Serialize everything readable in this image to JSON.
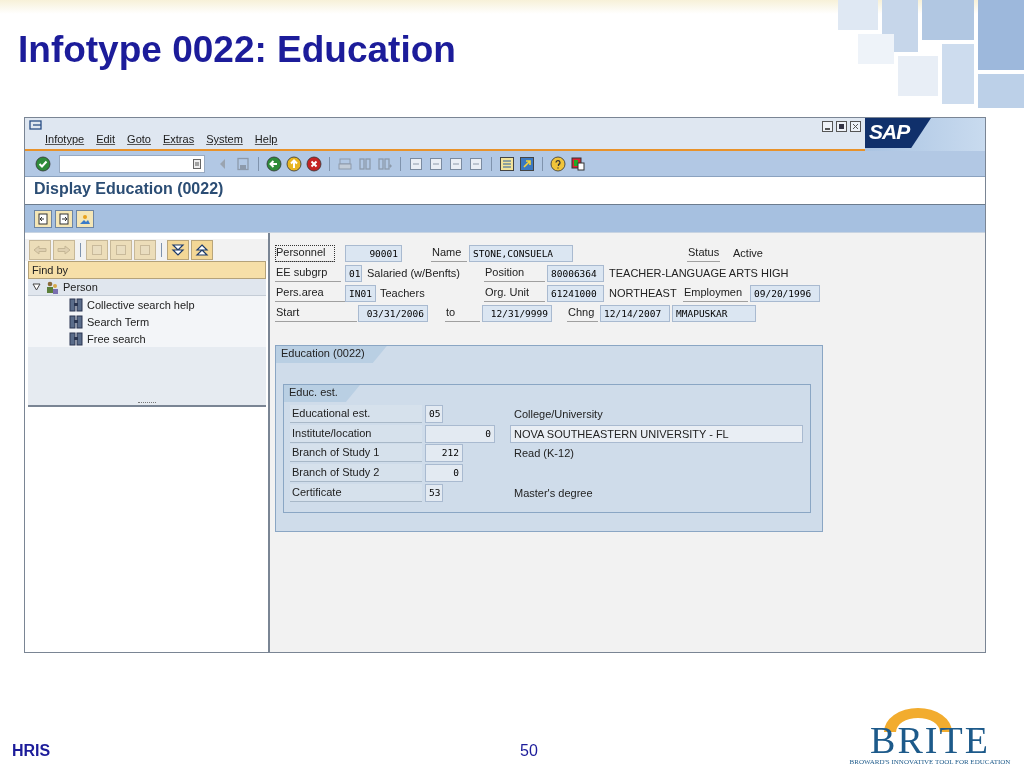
{
  "slide": {
    "title": "Infotype 0022: Education",
    "footer_left": "HRIS",
    "page_number": "50",
    "logo": {
      "name": "BRITE",
      "tagline": "BROWARD'S INNOVATIVE TOOL FOR EDUCATION"
    }
  },
  "window": {
    "menu": [
      {
        "label": "Infotype"
      },
      {
        "label": "Edit"
      },
      {
        "label": "Goto"
      },
      {
        "label": "Extras"
      },
      {
        "label": "System"
      },
      {
        "label": "Help"
      }
    ],
    "logo": "SAP",
    "screen_title": "Display Education (0022)",
    "navigator": {
      "find_by": "Find by",
      "tree": [
        {
          "label": "Person",
          "expanded": true,
          "children": [
            {
              "label": "Collective search help"
            },
            {
              "label": "Search Term"
            },
            {
              "label": "Free search"
            }
          ]
        }
      ]
    },
    "header": [
      [
        {
          "kind": "label",
          "text": "Personnel",
          "focused": true
        },
        {
          "kind": "field",
          "text": "90001"
        },
        {
          "kind": "label",
          "text": "Name",
          "focused": false
        },
        {
          "kind": "field",
          "text": "STONE,CONSUELA"
        },
        {
          "kind": "label",
          "text": "Status",
          "focused": false
        },
        {
          "kind": "text",
          "text": "Active"
        }
      ],
      [
        {
          "kind": "label",
          "text": "EE subgrp",
          "focused": false
        },
        {
          "kind": "field",
          "text": "01"
        },
        {
          "kind": "text",
          "text": "Salaried (w/Benfts)"
        },
        {
          "kind": "label",
          "text": "Position",
          "focused": false
        },
        {
          "kind": "field",
          "text": "80006364"
        },
        {
          "kind": "text",
          "text": "TEACHER-LANGUAGE ARTS HIGH"
        }
      ],
      [
        {
          "kind": "label",
          "text": "Pers.area",
          "focused": false
        },
        {
          "kind": "field",
          "text": "IN01"
        },
        {
          "kind": "text",
          "text": "Teachers"
        },
        {
          "kind": "label",
          "text": "Org. Unit",
          "focused": false
        },
        {
          "kind": "field",
          "text": "61241000"
        },
        {
          "kind": "text",
          "text": "NORTHEAST"
        },
        {
          "kind": "label",
          "text": "Employmen",
          "focused": false
        },
        {
          "kind": "field",
          "text": "09/20/1996"
        }
      ],
      [
        {
          "kind": "label",
          "text": "Start",
          "focused": false
        },
        {
          "kind": "field",
          "text": "03/31/2006"
        },
        {
          "kind": "label",
          "text": "to",
          "focused": false
        },
        {
          "kind": "field",
          "text": "12/31/9999"
        },
        {
          "kind": "label",
          "text": "Chng",
          "focused": false
        },
        {
          "kind": "field",
          "text": "12/14/2007"
        },
        {
          "kind": "field",
          "text": "MMAPUSKAR"
        }
      ]
    ],
    "education_frame": {
      "title": "Education (0022)",
      "group": {
        "title": "Educ. est.",
        "rows": [
          {
            "label": "Educational est.",
            "value": "05",
            "description": {
              "text": "College/University",
              "boxed": false
            }
          },
          {
            "label": "Institute/location",
            "value": "0",
            "description": {
              "text": "NOVA SOUTHEASTERN UNIVERSITY - FL",
              "boxed": true
            }
          },
          {
            "label": "Branch of Study 1",
            "value": "212",
            "description": {
              "text": "Read (K-12)",
              "boxed": false
            }
          },
          {
            "label": "Branch of Study 2",
            "value": "0"
          },
          {
            "label": "Certificate",
            "value": "53",
            "description": {
              "text": "Master's degree",
              "boxed": false
            }
          }
        ]
      }
    }
  }
}
